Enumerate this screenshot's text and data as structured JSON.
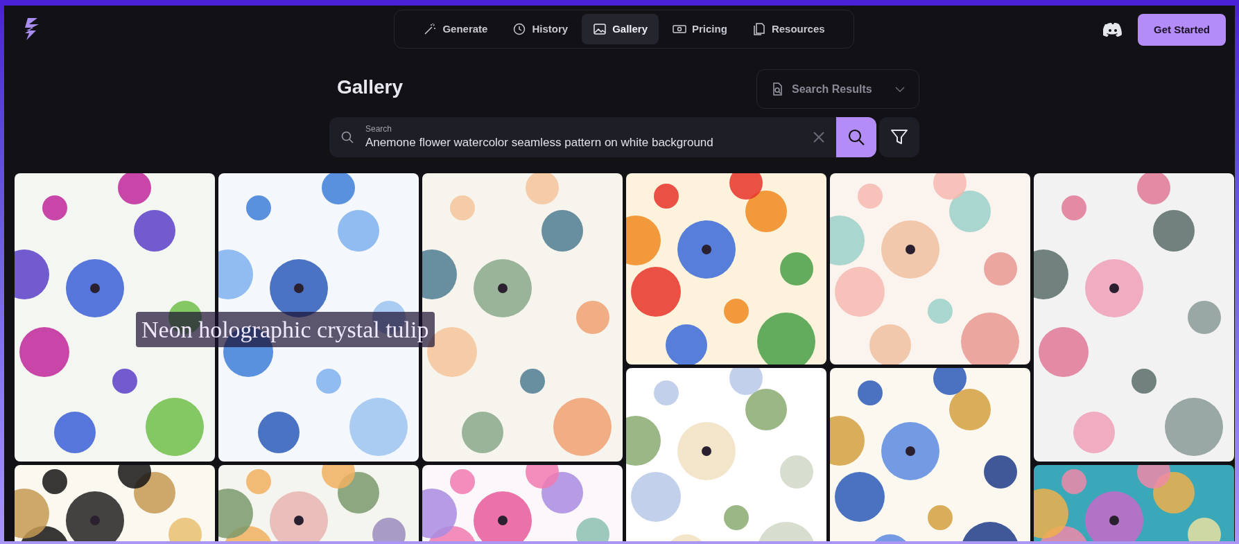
{
  "nav": {
    "tabs": [
      {
        "label": "Generate",
        "selected": false
      },
      {
        "label": "History",
        "selected": false
      },
      {
        "label": "Gallery",
        "selected": true
      },
      {
        "label": "Pricing",
        "selected": false
      },
      {
        "label": "Resources",
        "selected": false
      }
    ],
    "cta": "Get Started"
  },
  "page": {
    "title": "Gallery",
    "sort": {
      "value": "Search Results"
    },
    "search": {
      "label": "Search",
      "value": "Anemone flower watercolor seamless pattern on white background"
    }
  },
  "gallery": {
    "overlay_text": "Neon holographic crystal tulip"
  }
}
